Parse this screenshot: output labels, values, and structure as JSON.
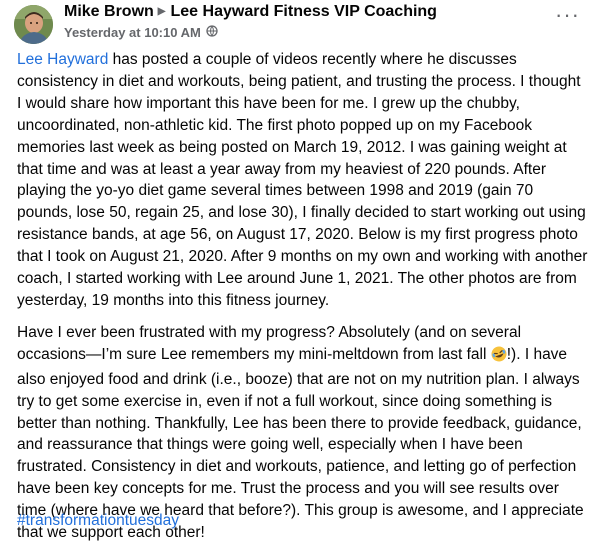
{
  "post": {
    "author": "Mike Brown",
    "group": "Lee Hayward Fitness VIP Coaching",
    "timestamp": "Yesterday at 10:10 AM",
    "more_label": "···",
    "paragraph1": {
      "mention": "Lee Hayward",
      "text": " has posted a couple of videos recently where he discusses consistency in diet and workouts, being patient, and trusting the process.  I thought I would share how important this have been for me.  I grew up the chubby, uncoordinated, non-athletic kid.  The first photo popped up on my Facebook memories last week as being posted on March 19, 2012.  I was gaining weight at that time and was at least a year away from my heaviest of 220 pounds.  After playing the yo-yo diet game several times between 1998 and 2019  (gain 70 pounds, lose 50, regain 25, and lose 30), I finally decided to start working out using resistance bands, at age 56, on August 17, 2020.  Below is my first progress photo that I took on August 21, 2020.  After 9 months on my own and working with another coach, I started working with Lee around June 1, 2021.  The other photos are from yesterday, 19 months into this fitness journey."
    },
    "paragraph2": {
      "before_emoji": "Have I ever been frustrated with my progress?  Absolutely (and on several occasions—I’m sure Lee remembers my mini-meltdown from last fall ",
      "after_emoji": "!).  I have also enjoyed food and drink (i.e., booze) that are not on my nutrition plan.  I always try to get some exercise in, even if not a full workout, since doing something is better than nothing.  Thankfully, Lee has been there to provide feedback, guidance, and reassurance that things were going well, especially when I have been frustrated.  Consistency in diet and workouts, patience, and letting go of perfection have been key concepts for me.  Trust the process and you will see results over time (where have we heard that before?).  This group is awesome, and I appreciate that we support each other!"
    },
    "hashtag": "#transformationtuesday"
  },
  "icons": {
    "avatar": "avatar-photo",
    "separator": "caret-right-icon",
    "audience": "globe-icon",
    "more": "more-icon",
    "emoji": "rolling-laughing-emoji"
  },
  "colors": {
    "link": "#216fdb",
    "text": "#050505",
    "meta": "#65676b"
  }
}
